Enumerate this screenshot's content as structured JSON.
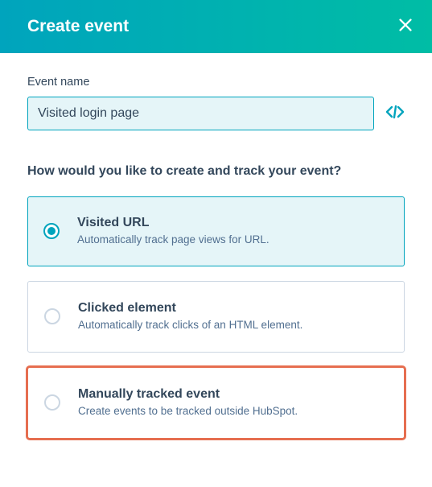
{
  "header": {
    "title": "Create event"
  },
  "form": {
    "event_name_label": "Event name",
    "event_name_value": "Visited login page",
    "question": "How would you like to create and track your event?"
  },
  "options": [
    {
      "title": "Visited URL",
      "desc": "Automatically track page views for URL.",
      "selected": true,
      "highlighted": false
    },
    {
      "title": "Clicked element",
      "desc": "Automatically track clicks of an HTML element.",
      "selected": false,
      "highlighted": false
    },
    {
      "title": "Manually tracked event",
      "desc": "Create events to be tracked outside HubSpot.",
      "selected": false,
      "highlighted": true
    }
  ]
}
